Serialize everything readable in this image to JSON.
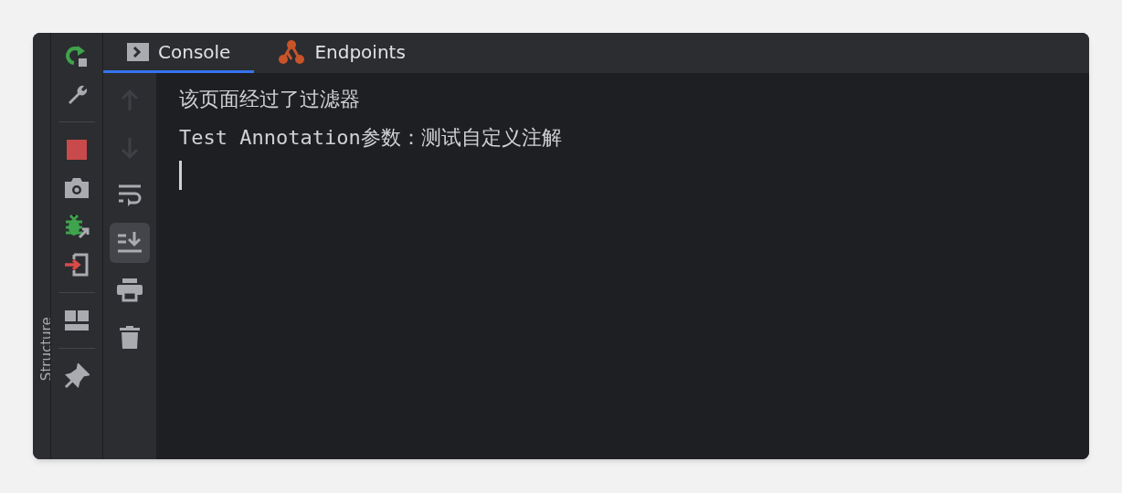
{
  "side_strip": {
    "label": "Structure"
  },
  "tabs": [
    {
      "label": "Console",
      "kind": "console",
      "selected": true
    },
    {
      "label": "Endpoints",
      "kind": "endpoints",
      "selected": false
    }
  ],
  "toolbar": [
    {
      "kind": "rerun"
    },
    {
      "kind": "wrench"
    },
    {
      "kind": "divider"
    },
    {
      "kind": "stop"
    },
    {
      "kind": "camera"
    },
    {
      "kind": "bug"
    },
    {
      "kind": "exit"
    },
    {
      "kind": "divider"
    },
    {
      "kind": "layout"
    },
    {
      "kind": "divider"
    },
    {
      "kind": "pin"
    }
  ],
  "console_actions": [
    {
      "kind": "up",
      "disabled": true,
      "selected": false
    },
    {
      "kind": "down",
      "disabled": true,
      "selected": false
    },
    {
      "kind": "wrap",
      "disabled": false,
      "selected": false
    },
    {
      "kind": "scroll-end",
      "disabled": false,
      "selected": true
    },
    {
      "kind": "print",
      "disabled": false,
      "selected": false
    },
    {
      "kind": "trash",
      "disabled": false,
      "selected": false
    }
  ],
  "console": {
    "lines": [
      "该页面经过了过滤器",
      "Test Annotation参数：测试自定义注解"
    ]
  }
}
